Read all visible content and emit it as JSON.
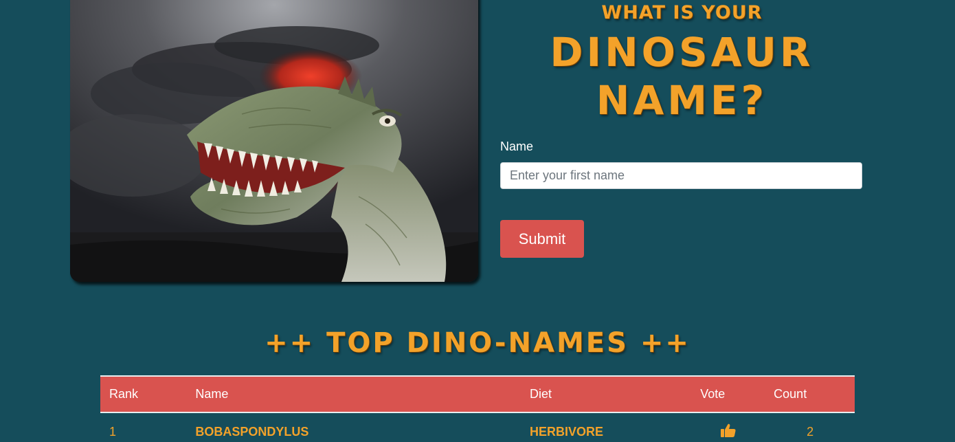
{
  "hero": {
    "image_alt": "Dinosaur head in front of an erupting volcano"
  },
  "title": {
    "line1": "What is your",
    "line2": "Dinosaur",
    "line3": "Name?"
  },
  "form": {
    "label": "Name",
    "placeholder": "Enter your first name",
    "value": "",
    "submit_label": "Submit"
  },
  "leaderboard": {
    "title": "++ Top Dino-Names ++",
    "columns": [
      "Rank",
      "Name",
      "Diet",
      "Vote",
      "Count"
    ],
    "rows": [
      {
        "rank": "1",
        "name": "BOBASPONDYLUS",
        "diet": "HERBIVORE",
        "vote_icon": "thumbs-up-icon",
        "count": "2"
      }
    ]
  },
  "colors": {
    "background": "#154d5b",
    "accent": "#f3a22a",
    "button": "#d9534f",
    "table_header": "#d9534f"
  }
}
